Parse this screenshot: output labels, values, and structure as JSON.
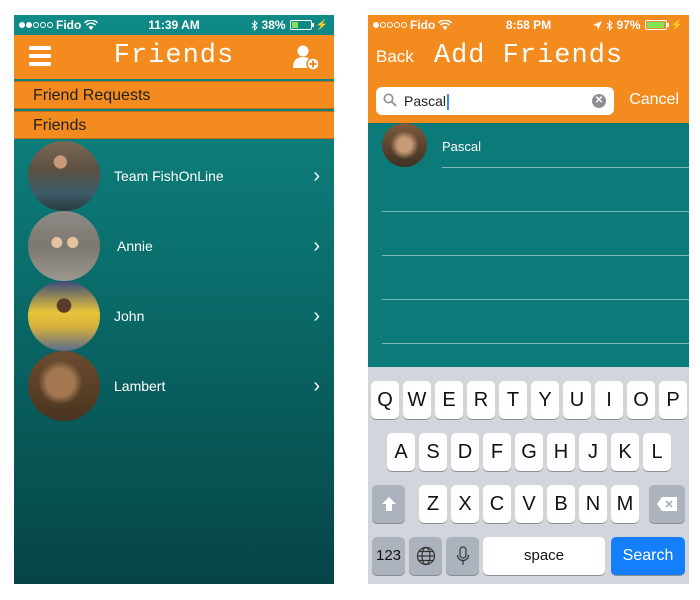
{
  "left": {
    "status": {
      "carrier": "Fido",
      "time": "11:39 AM",
      "battery": "38%",
      "battery_level": 0.38
    },
    "title": "Friends",
    "sections": {
      "requests": "Friend Requests",
      "friends": "Friends"
    },
    "friends": [
      {
        "name": "Team FishOnLine"
      },
      {
        "name": "Annie"
      },
      {
        "name": "John"
      },
      {
        "name": "Lambert"
      }
    ]
  },
  "right": {
    "status": {
      "carrier": "Fido",
      "time": "8:58 PM",
      "battery": "97%",
      "battery_level": 0.97
    },
    "back": "Back",
    "title": "Add Friends",
    "search_value": "Pascal",
    "cancel": "Cancel",
    "results": [
      {
        "name": "Pascal"
      }
    ],
    "keyboard": {
      "row1": [
        "Q",
        "W",
        "E",
        "R",
        "T",
        "Y",
        "U",
        "I",
        "O",
        "P"
      ],
      "row2": [
        "A",
        "S",
        "D",
        "F",
        "G",
        "H",
        "J",
        "K",
        "L"
      ],
      "row3": [
        "Z",
        "X",
        "C",
        "V",
        "B",
        "N",
        "M"
      ],
      "numbers": "123",
      "space": "space",
      "search": "Search"
    }
  },
  "colors": {
    "accent": "#f38b1f",
    "teal": "#0c7a78",
    "search_key": "#147efb"
  }
}
